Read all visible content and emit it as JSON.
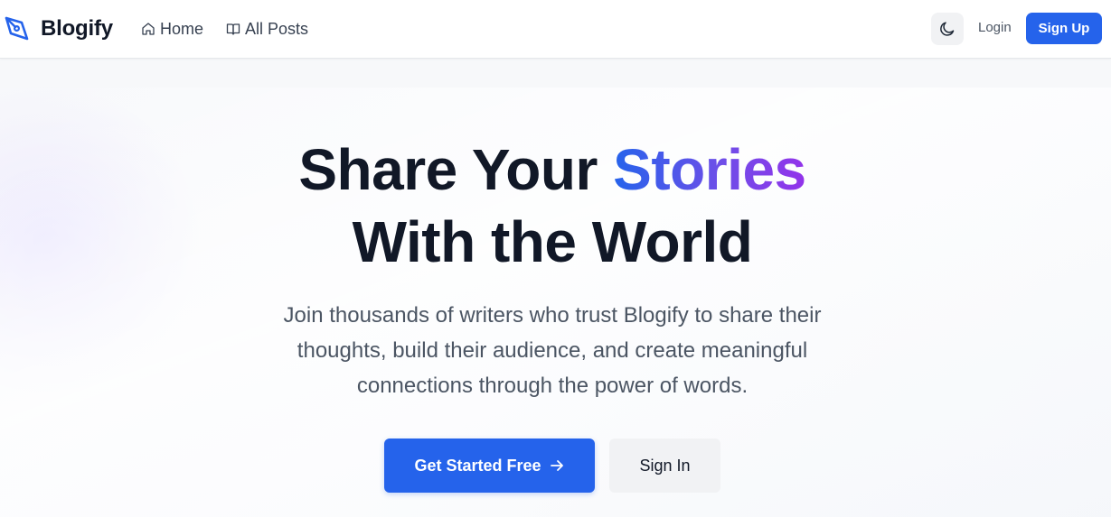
{
  "header": {
    "brand_name": "Blogify",
    "nav": {
      "home_label": "Home",
      "posts_label": "All Posts"
    },
    "theme_toggle_icon": "moon-icon",
    "login_label": "Login",
    "signup_label": "Sign Up"
  },
  "hero": {
    "headline_part1": "Share Your ",
    "headline_accent": "Stories",
    "headline_line2": "With the World",
    "subtext": "Join thousands of writers who trust Blogify to share their thoughts, build their audience, and create meaningful connections through the power of words.",
    "primary_cta_label": "Get Started Free",
    "primary_cta_icon": "arrow-right-icon",
    "secondary_cta_label": "Sign In"
  },
  "colors": {
    "accent": "#2563eb",
    "accent_gradient_end": "#9333ea",
    "heading": "#111827",
    "body_text": "#4b5563"
  }
}
